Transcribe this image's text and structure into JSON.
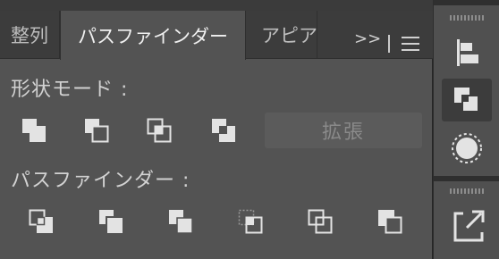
{
  "tabs": {
    "items": [
      {
        "label": "整列"
      },
      {
        "label": "パスファインダー"
      },
      {
        "label": "アピアランス"
      }
    ],
    "overflow_label": ">>"
  },
  "shape_modes": {
    "label": "形状モード :",
    "buttons": [
      "unite-icon",
      "minus-front-icon",
      "intersect-icon",
      "exclude-icon"
    ],
    "expand_label": "拡張"
  },
  "pathfinders": {
    "label": "パスファインダー :",
    "buttons": [
      "divide-icon",
      "trim-icon",
      "merge-icon",
      "crop-icon",
      "outline-icon",
      "minus-back-icon"
    ]
  },
  "side_panel": {
    "tools": [
      "align-icon",
      "pathfinder-icon",
      "appearance-icon",
      "export-icon"
    ]
  },
  "colors": {
    "panel_bg": "#535353",
    "tab_bar_bg": "#3c3c3c",
    "icon_light": "#e3e3e3"
  }
}
